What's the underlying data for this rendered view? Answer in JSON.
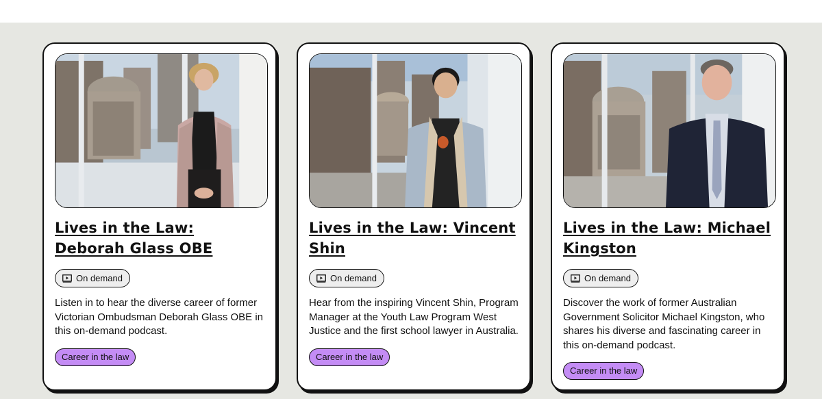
{
  "theme": {
    "section_bg": "#e6e7e2",
    "card_bg": "#ffffff",
    "tag_color": "#c48cf5",
    "badge_bg": "#eeeeee"
  },
  "cards": [
    {
      "title": "Lives in the Law: Deborah Glass OBE",
      "badge_icon": "play-video-icon",
      "badge": "On demand",
      "description": "Listen in to hear the diverse career of former Victorian Ombudsman Deborah Glass OBE in this on-demand podcast.",
      "tag": "Career in the law"
    },
    {
      "title": "Lives in the Law: Vincent Shin",
      "badge_icon": "play-video-icon",
      "badge": "On demand",
      "description": "Hear from the inspiring Vincent Shin, Program Manager at the Youth Law Program West Justice and the first school lawyer in Australia.",
      "tag": "Career in the law"
    },
    {
      "title": "Lives in the Law: Michael Kingston",
      "badge_icon": "play-video-icon",
      "badge": "On demand",
      "description": "Discover the work of former Australian Government Solicitor Michael Kingston, who shares his diverse and fascinating career in this on-demand podcast.",
      "tag": "Career in the law"
    }
  ]
}
